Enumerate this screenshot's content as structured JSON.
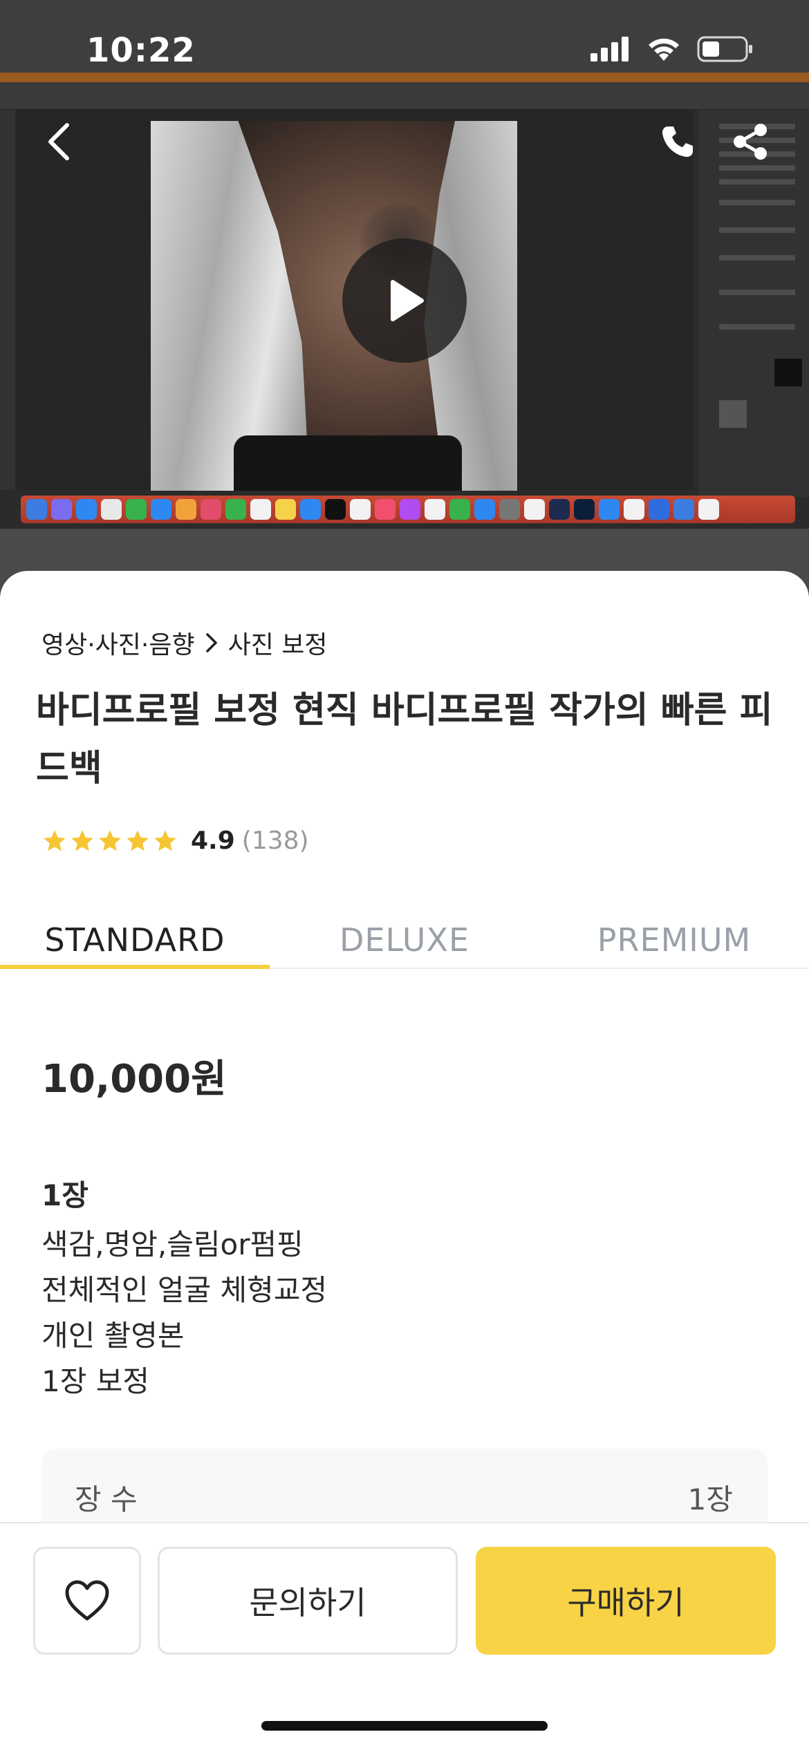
{
  "status_bar": {
    "time": "10:22"
  },
  "media": {
    "back_icon": "chevron-left-icon",
    "phone_icon": "phone-icon",
    "share_icon": "share-icon",
    "play_icon": "play-icon"
  },
  "breadcrumb": {
    "category": "영상·사진·음향",
    "subcategory": "사진 보정"
  },
  "title": "바디프로필 보정 현직 바디프로필 작가의 빠른 피드백",
  "rating": {
    "score": "4.9",
    "count": "(138)",
    "stars": 5,
    "star_color": "#f5c534"
  },
  "tabs": [
    {
      "label": "STANDARD",
      "active": true
    },
    {
      "label": "DELUXE",
      "active": false
    },
    {
      "label": "PREMIUM",
      "active": false
    }
  ],
  "package": {
    "price": "10,000원",
    "name": "1장",
    "description": [
      "색감,명암,슬림or펌핑",
      "전체적인 얼굴 체형교정",
      "개인 촬영본",
      "1장 보정"
    ],
    "spec": {
      "label": "장 수",
      "value": "1장"
    }
  },
  "actions": {
    "favorite_icon": "heart-icon",
    "inquiry_label": "문의하기",
    "buy_label": "구매하기",
    "accent_color": "#f7d345"
  }
}
